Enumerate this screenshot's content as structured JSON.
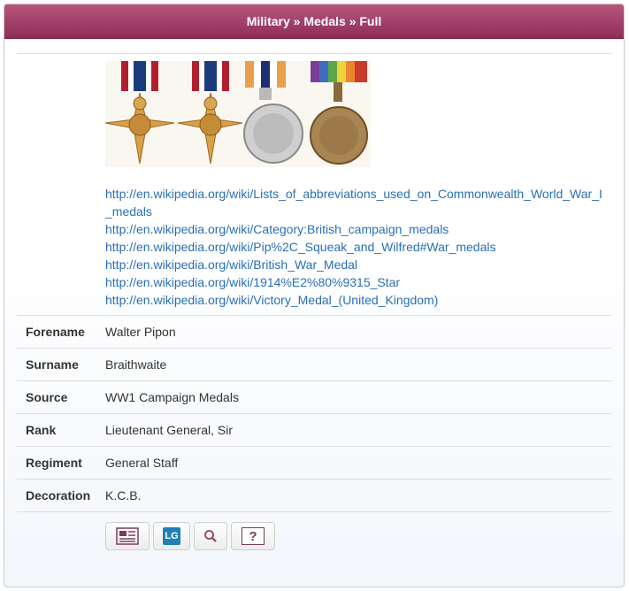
{
  "header": {
    "breadcrumb": [
      "Military",
      "Medals",
      "Full"
    ],
    "separator": "»"
  },
  "medals_image": {
    "ribbons": [
      "#b11f2e",
      "#b11f2e",
      "#1d2f6e",
      "#7a3e9a"
    ],
    "icons": [
      "star-medal-icon",
      "star-medal-icon",
      "silver-medal-icon",
      "bronze-medal-icon"
    ]
  },
  "links": [
    "http://en.wikipedia.org/wiki/Lists_of_abbreviations_used_on_Commonwealth_World_War_I_medals",
    "http://en.wikipedia.org/wiki/Category:British_campaign_medals",
    "http://en.wikipedia.org/wiki/Pip%2C_Squeak_and_Wilfred#War_medals",
    "http://en.wikipedia.org/wiki/British_War_Medal",
    "http://en.wikipedia.org/wiki/1914%E2%80%9315_Star",
    "http://en.wikipedia.org/wiki/Victory_Medal_(United_Kingdom)"
  ],
  "record": {
    "forename": {
      "label": "Forename",
      "value": "Walter Pipon"
    },
    "surname": {
      "label": "Surname",
      "value": "Braithwaite"
    },
    "source": {
      "label": "Source",
      "value": "WW1 Campaign Medals"
    },
    "rank": {
      "label": "Rank",
      "value": "Lieutenant General, Sir"
    },
    "regiment": {
      "label": "Regiment",
      "value": "General Staff"
    },
    "decoration": {
      "label": "Decoration",
      "value": "K.C.B."
    }
  },
  "toolbar": {
    "buttons": [
      {
        "icon": "newspaper-icon"
      },
      {
        "icon": "london-gazette-icon",
        "text": "LG"
      },
      {
        "icon": "search-icon"
      },
      {
        "icon": "help-icon",
        "text": "?"
      }
    ]
  },
  "colors": {
    "header_top": "#b8577d",
    "header_bottom": "#8e2e57",
    "link": "#2a6fb5"
  }
}
